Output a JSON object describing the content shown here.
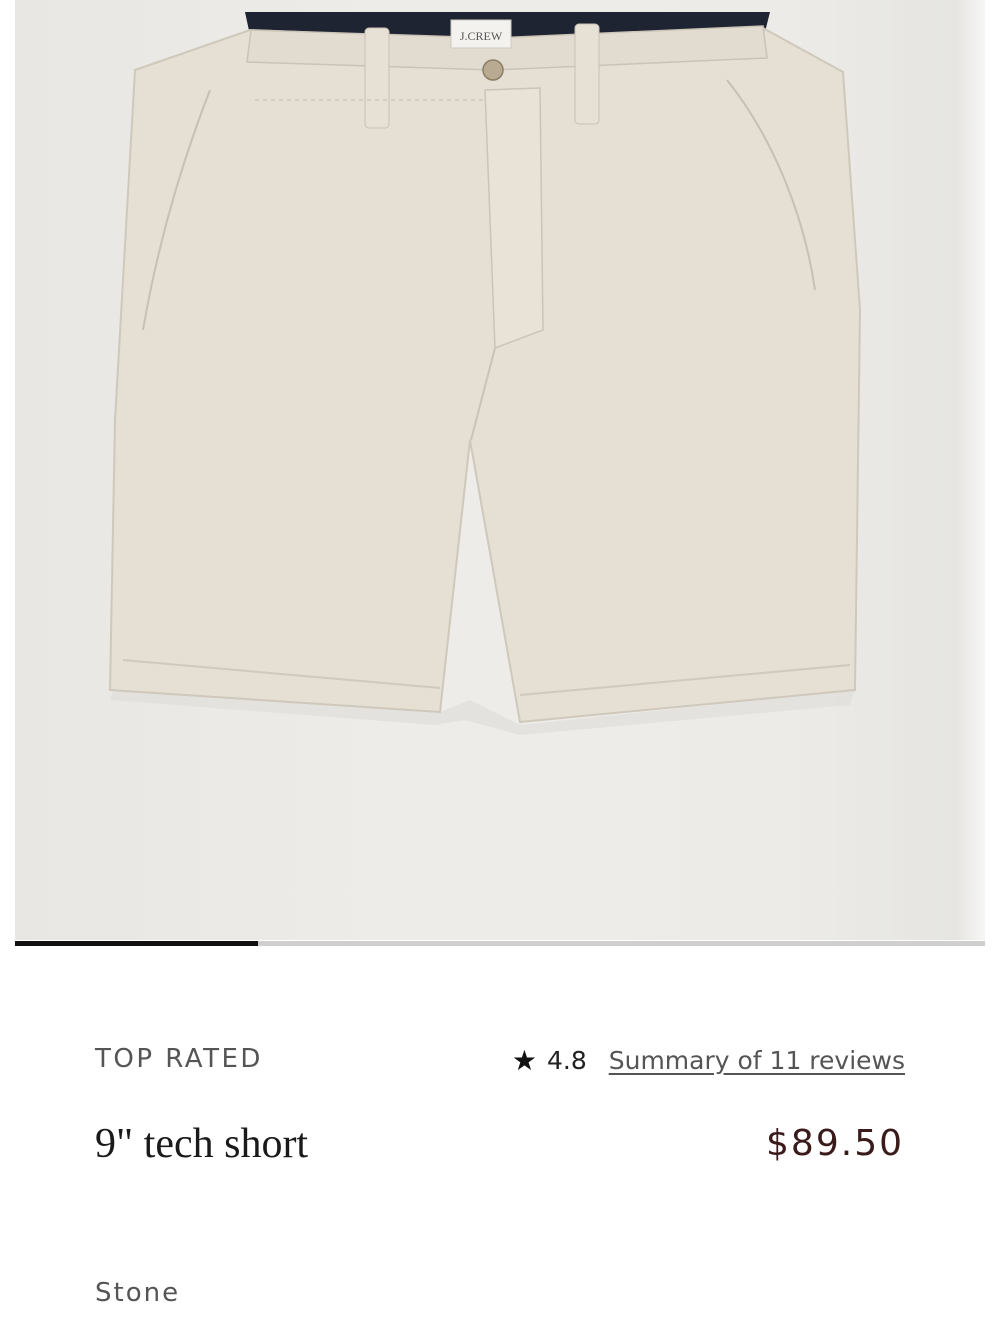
{
  "product": {
    "brand_label": "J.CREW",
    "badge": "TOP RATED",
    "rating": "4.8",
    "reviews_link": "Summary of 11 reviews",
    "title": "9\" tech short",
    "price": "$89.50",
    "color": "Stone"
  },
  "carousel": {
    "progress": 0.25
  },
  "icons": {
    "star": "star-icon"
  }
}
